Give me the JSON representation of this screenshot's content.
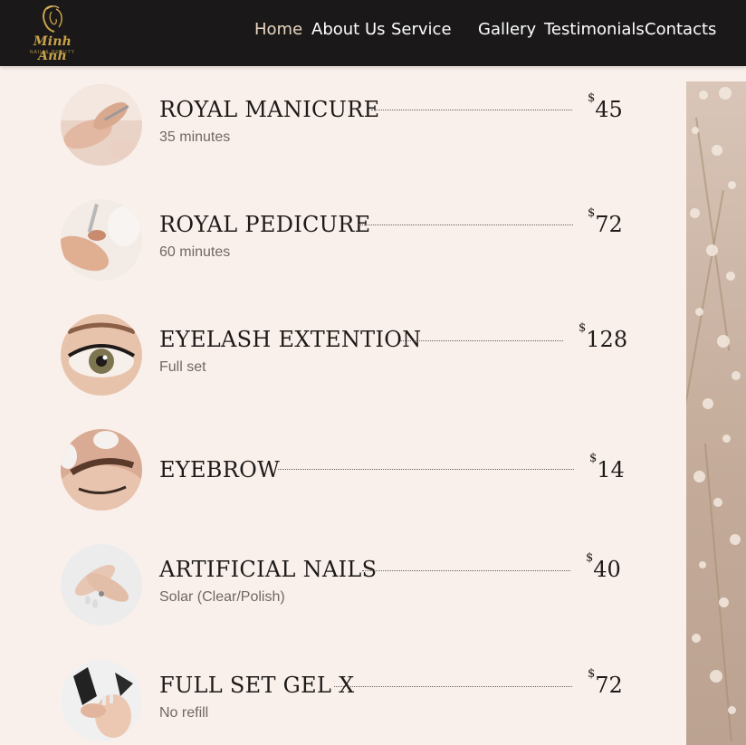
{
  "brand": {
    "name": "Minh Anh",
    "tagline": "NAIL & BEAUTY"
  },
  "nav": {
    "items": [
      {
        "label": "Home",
        "active": true
      },
      {
        "label": "About Us"
      },
      {
        "label": "Service"
      },
      {
        "label": "Gallery"
      },
      {
        "label": "Testimonials"
      },
      {
        "label": "Contacts"
      }
    ]
  },
  "currency_symbol": "$",
  "services": [
    {
      "title": "ROYAL MANICURE",
      "price": "45",
      "detail": "35 minutes",
      "image": "manicure-photo"
    },
    {
      "title": "ROYAL PEDICURE",
      "price": "72",
      "detail": "60 minutes",
      "image": "pedicure-photo"
    },
    {
      "title": "EYELASH EXTENTION",
      "price": "128",
      "detail": "Full set",
      "image": "eyelash-photo"
    },
    {
      "title": "EYEBROW",
      "price": "14",
      "detail": "",
      "image": "eyebrow-photo"
    },
    {
      "title": "ARTIFICIAL NAILS",
      "price": "40",
      "detail": "Solar (Clear/Polish)",
      "image": "artificial-nails-photo"
    },
    {
      "title": "FULL SET GEL X",
      "price": "72",
      "detail": "No refill",
      "image": "gel-x-photo"
    }
  ],
  "colors": {
    "header_bg": "#1a1818",
    "page_bg": "#faf0eb",
    "accent_gold": "#c9a24a",
    "nav_active": "#e8d4c0"
  }
}
